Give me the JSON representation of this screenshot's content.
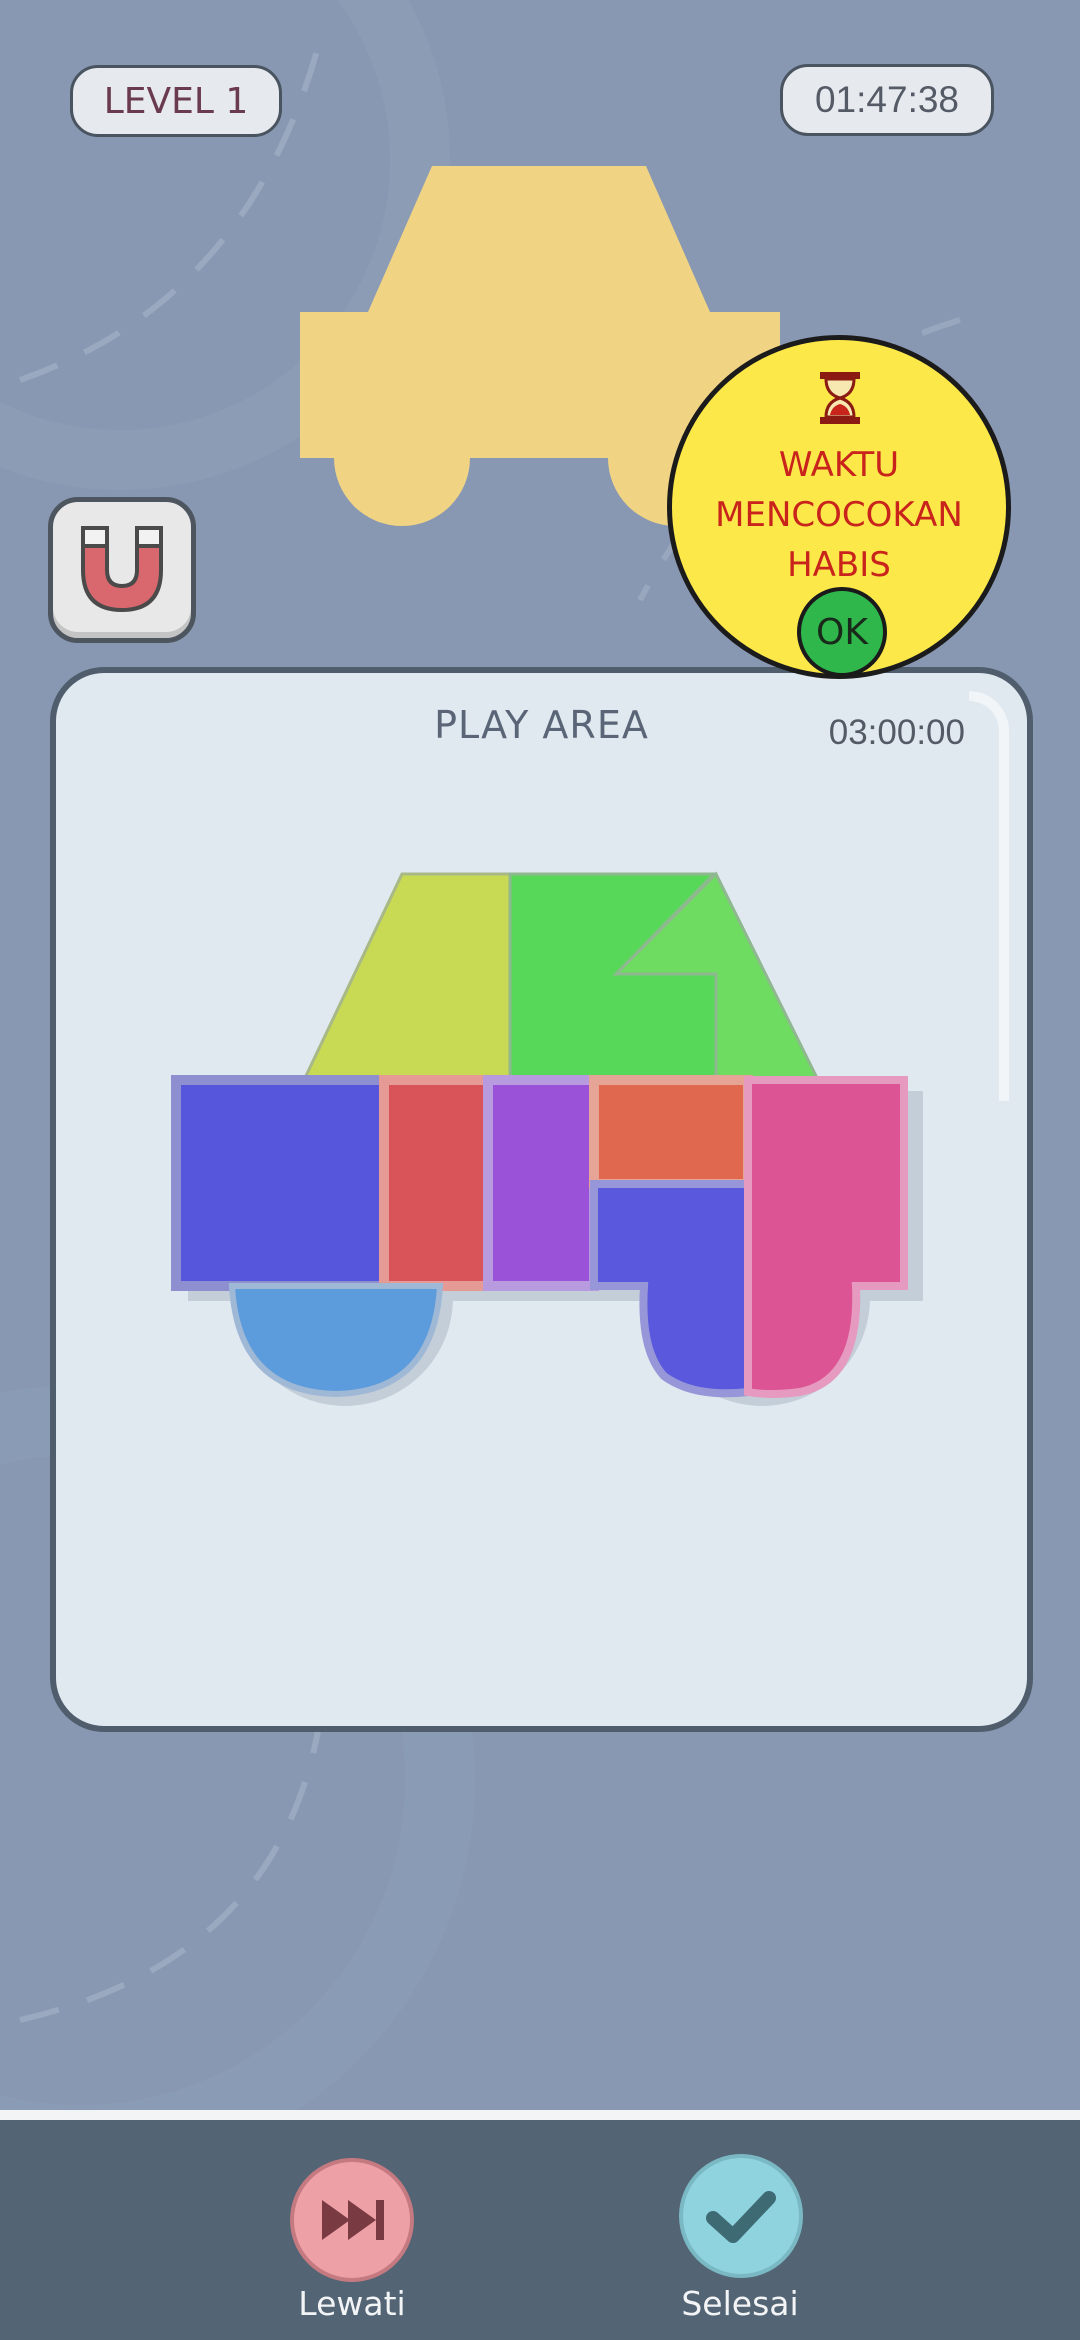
{
  "header": {
    "level_label": "LEVEL 1",
    "timer": "01:47:38"
  },
  "target_shape": {
    "name": "car",
    "color": "#f0d484"
  },
  "magnet": {
    "icon": "magnet-icon"
  },
  "play_area": {
    "title": "PLAY AREA",
    "timer": "03:00:00",
    "pieces": [
      {
        "name": "trapezoid-left",
        "color": "#c8da54"
      },
      {
        "name": "green-quad",
        "color": "#58d858"
      },
      {
        "name": "green-triangle",
        "color": "#6edc60"
      },
      {
        "name": "blue-square",
        "color": "#5656dc"
      },
      {
        "name": "red-bar",
        "color": "#d95458"
      },
      {
        "name": "purple-bar",
        "color": "#9a52d8"
      },
      {
        "name": "orange-rect",
        "color": "#e0684e"
      },
      {
        "name": "blue-l-wheel",
        "color": "#5a58dc"
      },
      {
        "name": "pink-j-wheel",
        "color": "#dc5494"
      },
      {
        "name": "blue-half-wheel",
        "color": "#5c9cdc"
      }
    ]
  },
  "popup": {
    "icon": "hourglass-icon",
    "message": "WAKTU\nMENCOCOKAN\nHABIS",
    "ok_label": "OK",
    "colors": {
      "background": "#fde84a",
      "text": "#c8241c",
      "ok": "#2fb74c"
    }
  },
  "bottom_bar": {
    "skip_label": "Lewati",
    "done_label": "Selesai",
    "skip_icon": "fast-forward-icon",
    "done_icon": "checkmark-icon"
  }
}
